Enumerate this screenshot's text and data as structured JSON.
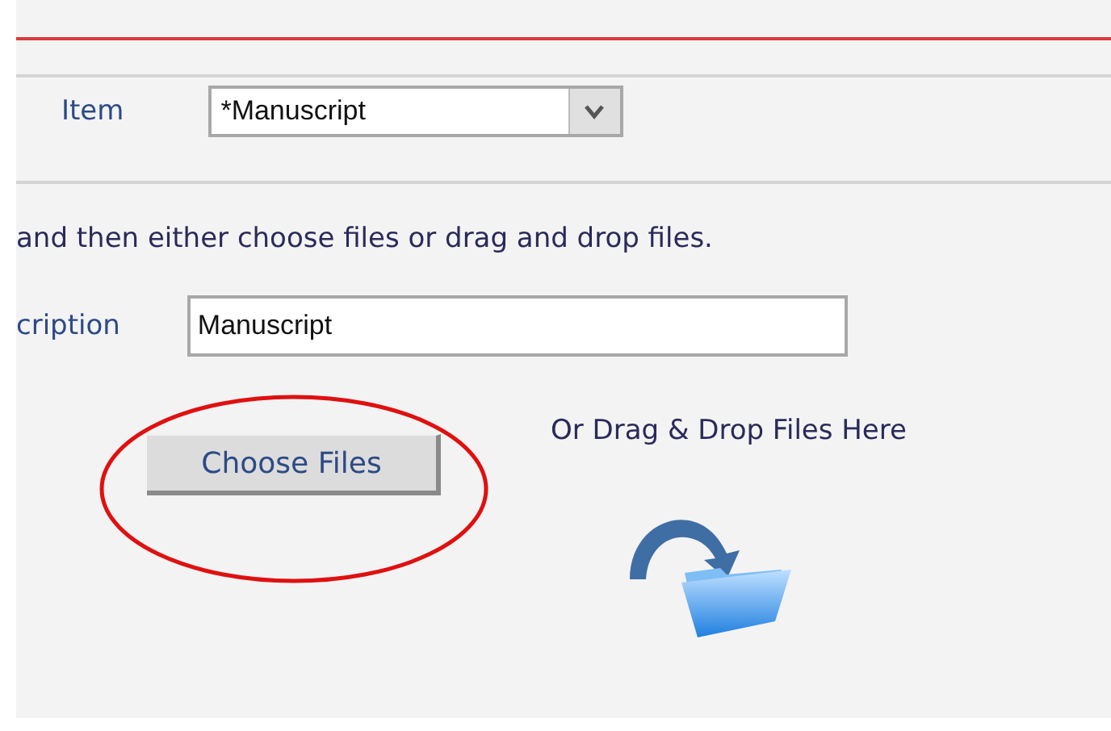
{
  "item_field": {
    "label": "Item",
    "value": "*Manuscript"
  },
  "instruction": "and then either choose files or drag and drop files.",
  "description_field": {
    "label": "cription",
    "value": "Manuscript"
  },
  "choose_button": {
    "label": "Choose Files",
    "highlighted": true
  },
  "drop_zone": {
    "label": "Or Drag & Drop Files Here"
  }
}
